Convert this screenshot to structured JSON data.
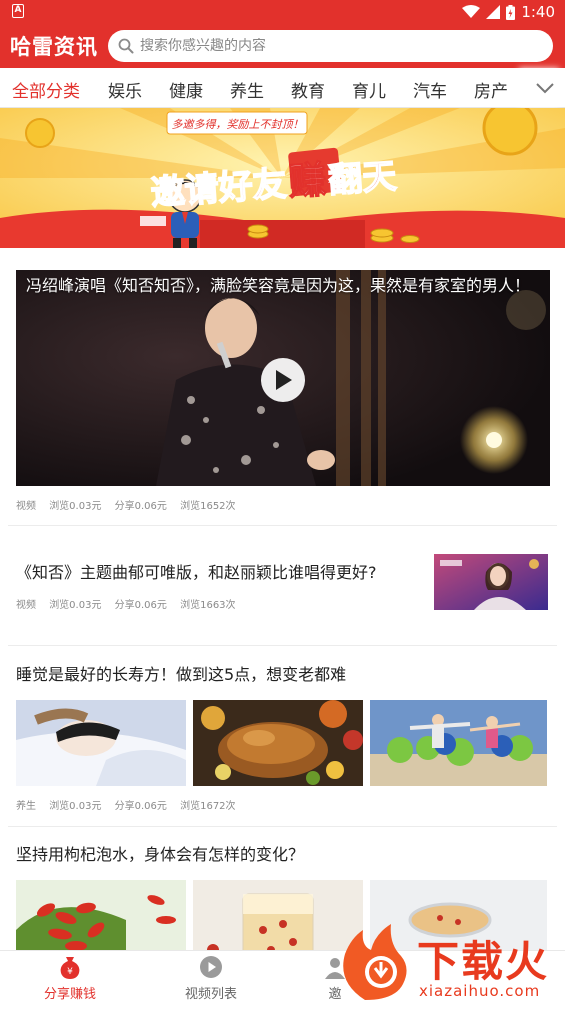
{
  "status_bar": {
    "notification_letter": "A",
    "time": "1:40"
  },
  "header": {
    "app_name": "哈雷资讯",
    "search_placeholder": "搜索你感兴趣的内容"
  },
  "categories": {
    "items": [
      "全部分类",
      "娱乐",
      "健康",
      "养生",
      "教育",
      "育儿",
      "汽车",
      "房产"
    ],
    "active_index": 0
  },
  "banner": {
    "tagline": "多邀多得，奖励上不封顶！",
    "headline_part1": "邀请好友",
    "headline_part2": "赚",
    "headline_part3": "翻天"
  },
  "feed": [
    {
      "type": "video",
      "title": "冯绍峰演唱《知否知否》，满脸笑容竟是因为这，果然是有家室的男人！",
      "tag": "视频",
      "browse_reward": "浏览0.03元",
      "share_reward": "分享0.06元",
      "views": "浏览1652次"
    },
    {
      "type": "single-image",
      "title": "《知否》主题曲郁可唯版，和赵丽颖比谁唱得更好?",
      "tag": "视频",
      "browse_reward": "浏览0.03元",
      "share_reward": "分享0.06元",
      "views": "浏览1663次"
    },
    {
      "type": "three-image",
      "title": "睡觉是最好的长寿方！做到这5点，想变老都难",
      "tag": "养生",
      "browse_reward": "浏览0.03元",
      "share_reward": "分享0.06元",
      "views": "浏览1672次"
    },
    {
      "type": "three-image",
      "title": "坚持用枸杞泡水，身体会有怎样的变化？"
    }
  ],
  "bottom_nav": {
    "items": [
      {
        "label": "分享赚钱",
        "icon": "money-bag-icon"
      },
      {
        "label": "视频列表",
        "icon": "play-circle-icon"
      },
      {
        "label": "邀",
        "icon": "invite-icon"
      }
    ],
    "active_index": 0
  },
  "watermark": {
    "brand": "下载火",
    "url": "xiazaihuo.com"
  },
  "colors": {
    "accent": "#e2312c",
    "text": "#222222",
    "meta": "#8a8a8a"
  }
}
